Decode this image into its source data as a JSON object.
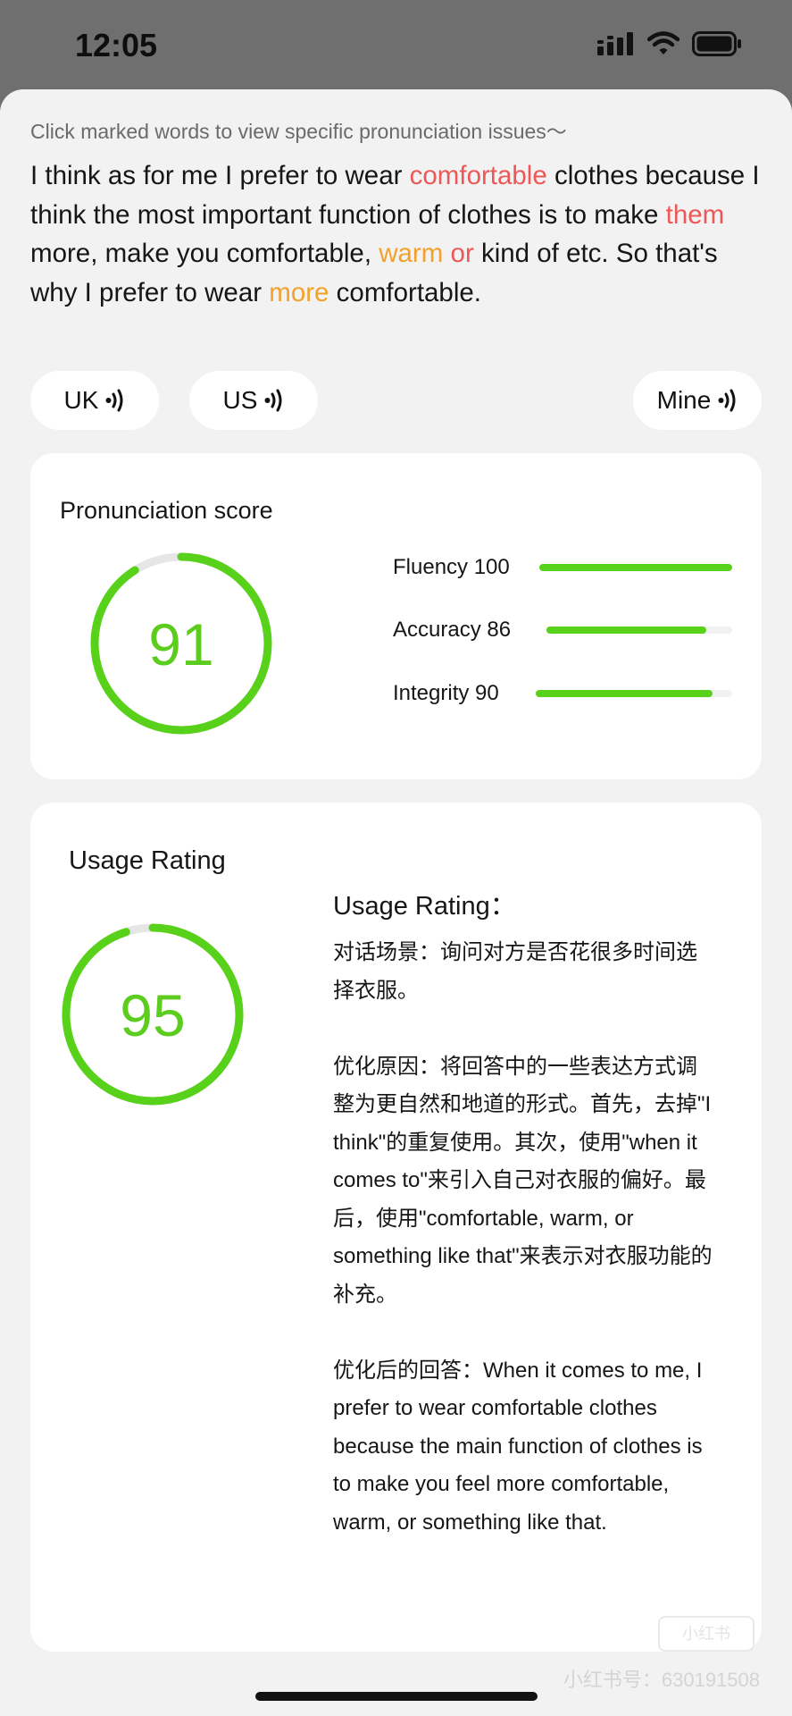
{
  "status_bar": {
    "time": "12:05",
    "icons": [
      "signal-icon",
      "wifi-icon",
      "battery-icon"
    ]
  },
  "hint": "Click marked words to view specific pronunciation issues～",
  "transcript": {
    "segments": [
      {
        "text": "I think as for me I prefer to wear ",
        "style": "normal"
      },
      {
        "text": "comfortable",
        "style": "red"
      },
      {
        "text": " clothes because I think the most important function of clothes is to make ",
        "style": "normal"
      },
      {
        "text": "them",
        "style": "red"
      },
      {
        "text": " more, make you comfortable, ",
        "style": "normal"
      },
      {
        "text": "warm",
        "style": "orange"
      },
      {
        "text": " ",
        "style": "normal"
      },
      {
        "text": "or",
        "style": "red"
      },
      {
        "text": " kind of etc. So that's why I prefer to wear ",
        "style": "normal"
      },
      {
        "text": "more",
        "style": "orange"
      },
      {
        "text": " comfortable.",
        "style": "normal"
      }
    ],
    "colors": {
      "red": "#ec5858",
      "orange": "#f2a12a"
    }
  },
  "audio_buttons": {
    "uk": "UK",
    "us": "US",
    "mine": "Mine"
  },
  "pronunciation": {
    "title": "Pronunciation score",
    "score": 91,
    "metrics": [
      {
        "label": "Fluency 100",
        "value": 100
      },
      {
        "label": "Accuracy 86",
        "value": 86
      },
      {
        "label": "Integrity 90",
        "value": 90
      }
    ]
  },
  "usage": {
    "title": "Usage Rating",
    "score": 95,
    "heading": "Usage Rating：",
    "paragraphs": [
      "对话场景：询问对方是否花很多时间选择衣服。",
      "优化原因：将回答中的一些表达方式调整为更自然和地道的形式。首先，去掉\"I think\"的重复使用。其次，使用\"when it comes to\"来引入自己对衣服的偏好。最后，使用\"comfortable, warm, or something like that\"来表示对衣服功能的补充。",
      "优化后的回答：When it comes to me, I prefer to wear comfortable clothes because the main function of clothes is to make you feel more comfortable, warm, or something like that."
    ]
  },
  "watermark": {
    "logo": "小红书",
    "text": "小红书号：630191508"
  },
  "theme": {
    "accent_green": "#58d11a",
    "score_text_green": "#5ccc1e",
    "ring_track": "#e6e6e6"
  }
}
